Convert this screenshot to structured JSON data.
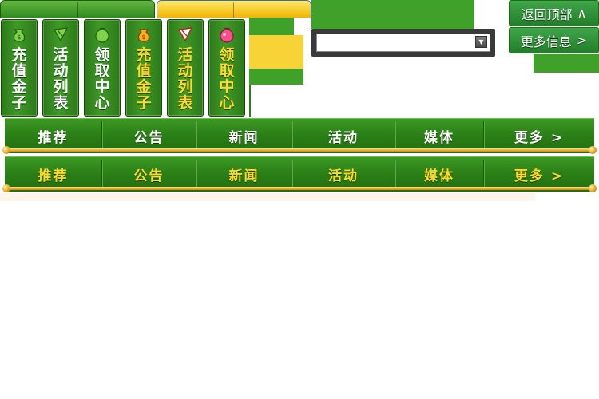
{
  "vertical_menu": [
    {
      "label": "充值金子",
      "icon": "money-bag-icon",
      "style": "white"
    },
    {
      "label": "活动列表",
      "icon": "flag-icon",
      "style": "white"
    },
    {
      "label": "领取中心",
      "icon": "gift-icon",
      "style": "white"
    },
    {
      "label": "充值金子",
      "icon": "money-bag-icon",
      "style": "yellow"
    },
    {
      "label": "活动列表",
      "icon": "flag-icon",
      "style": "yellow"
    },
    {
      "label": "领取中心",
      "icon": "gift-icon",
      "style": "yellow"
    }
  ],
  "side_buttons": {
    "back_to_top": {
      "label": "返回顶部",
      "icon": "chevron-up-icon",
      "glyph": "∧"
    },
    "more_info": {
      "label": "更多信息",
      "icon": "chevron-right-icon",
      "glyph": ">"
    }
  },
  "select": {
    "value": "",
    "arrow": "▼"
  },
  "nav_bars": [
    {
      "style": "white",
      "items": [
        "推荐",
        "公告",
        "新闻",
        "活动",
        "媒体",
        "更多 >"
      ]
    },
    {
      "style": "yellow",
      "items": [
        "推荐",
        "公告",
        "新闻",
        "活动",
        "媒体",
        "更多 >"
      ]
    }
  ],
  "colors": {
    "green": "#2f8a1f",
    "bright_green": "#3fa02a",
    "yellow": "#ffd92a",
    "block_yellow": "#f7d337"
  }
}
